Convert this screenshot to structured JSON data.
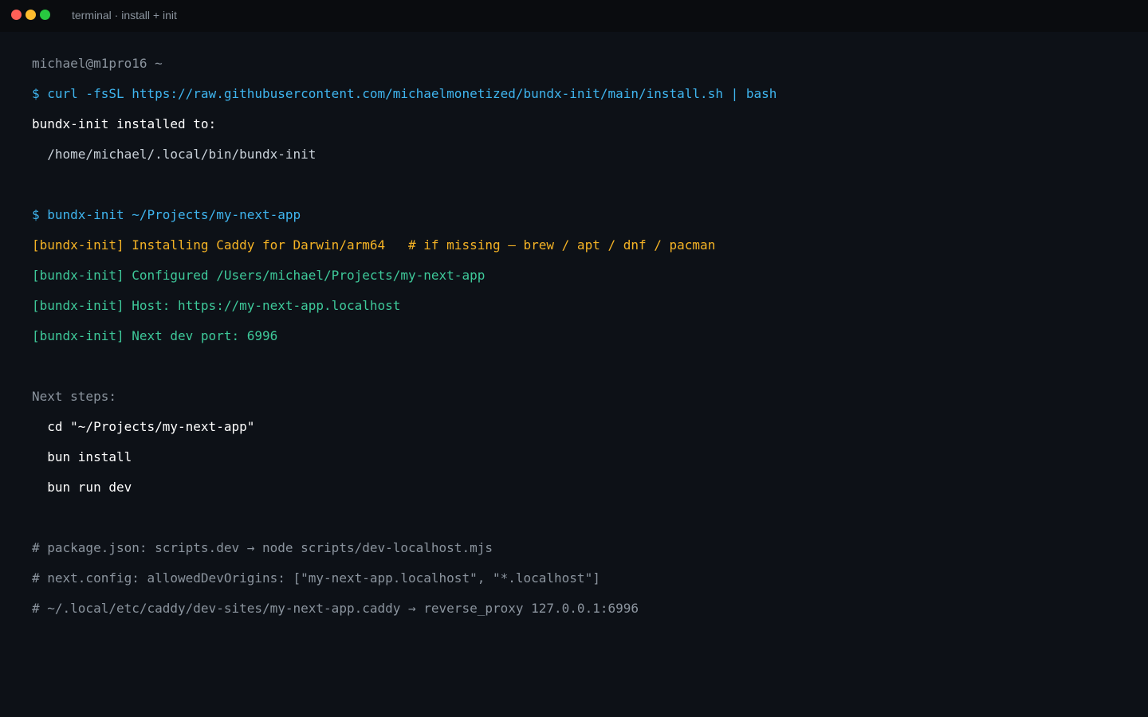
{
  "window": {
    "title": "terminal · install + init",
    "controls": {
      "close_color": "#ff5f57",
      "minimize_color": "#febc2e",
      "maximize_color": "#28c840"
    }
  },
  "colors": {
    "background": "#0d1117",
    "titlebar": "#0a0c0f",
    "prompt": "#8b949e",
    "command": "#3fb5ef",
    "output": "#ffffff",
    "path": "#c9d1d9",
    "warning": "#f5b325",
    "success": "#3ec99a",
    "comment": "#8b949e"
  },
  "lines": [
    {
      "text": "michael@m1pro16 ~",
      "kind": "prompt"
    },
    {
      "text": "$ curl -fsSL https://raw.githubusercontent.com/michaelmonetized/bundx-init/main/install.sh | bash",
      "kind": "command"
    },
    {
      "text": "bundx-init installed to:",
      "kind": "output"
    },
    {
      "text": "  /home/michael/.local/bin/bundx-init",
      "kind": "path"
    },
    {
      "text": "",
      "kind": "blank"
    },
    {
      "text": "$ bundx-init ~/Projects/my-next-app",
      "kind": "command"
    },
    {
      "text": "[bundx-init] Installing Caddy for Darwin/arm64   # if missing — brew / apt / dnf / pacman",
      "kind": "warning"
    },
    {
      "text": "[bundx-init] Configured /Users/michael/Projects/my-next-app",
      "kind": "success"
    },
    {
      "text": "[bundx-init] Host: https://my-next-app.localhost",
      "kind": "success"
    },
    {
      "text": "[bundx-init] Next dev port: 6996",
      "kind": "success"
    },
    {
      "text": "",
      "kind": "blank"
    },
    {
      "text": "Next steps:",
      "kind": "prompt"
    },
    {
      "text": "  cd \"~/Projects/my-next-app\"",
      "kind": "output"
    },
    {
      "text": "  bun install",
      "kind": "output"
    },
    {
      "text": "  bun run dev",
      "kind": "output"
    },
    {
      "text": "",
      "kind": "blank"
    },
    {
      "text": "# package.json: scripts.dev → node scripts/dev-localhost.mjs",
      "kind": "comment"
    },
    {
      "text": "# next.config: allowedDevOrigins: [\"my-next-app.localhost\", \"*.localhost\"]",
      "kind": "comment"
    },
    {
      "text": "# ~/.local/etc/caddy/dev-sites/my-next-app.caddy → reverse_proxy 127.0.0.1:6996",
      "kind": "comment"
    }
  ]
}
